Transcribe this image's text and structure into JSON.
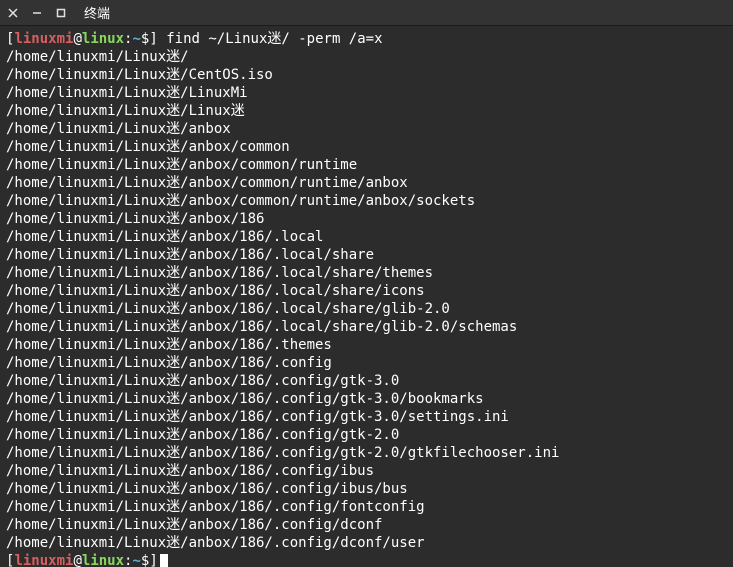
{
  "window": {
    "title": "终端"
  },
  "prompt": {
    "user": "linuxmi",
    "host": "linux",
    "path": "~",
    "bracket_open": "[",
    "bracket_close": "]",
    "at": "@",
    "colon": ":",
    "dollar": "$"
  },
  "command": "find ~/Linux迷/ -perm /a=x",
  "output": [
    "/home/linuxmi/Linux迷/",
    "/home/linuxmi/Linux迷/CentOS.iso",
    "/home/linuxmi/Linux迷/LinuxMi",
    "/home/linuxmi/Linux迷/Linux迷",
    "/home/linuxmi/Linux迷/anbox",
    "/home/linuxmi/Linux迷/anbox/common",
    "/home/linuxmi/Linux迷/anbox/common/runtime",
    "/home/linuxmi/Linux迷/anbox/common/runtime/anbox",
    "/home/linuxmi/Linux迷/anbox/common/runtime/anbox/sockets",
    "/home/linuxmi/Linux迷/anbox/186",
    "/home/linuxmi/Linux迷/anbox/186/.local",
    "/home/linuxmi/Linux迷/anbox/186/.local/share",
    "/home/linuxmi/Linux迷/anbox/186/.local/share/themes",
    "/home/linuxmi/Linux迷/anbox/186/.local/share/icons",
    "/home/linuxmi/Linux迷/anbox/186/.local/share/glib-2.0",
    "/home/linuxmi/Linux迷/anbox/186/.local/share/glib-2.0/schemas",
    "/home/linuxmi/Linux迷/anbox/186/.themes",
    "/home/linuxmi/Linux迷/anbox/186/.config",
    "/home/linuxmi/Linux迷/anbox/186/.config/gtk-3.0",
    "/home/linuxmi/Linux迷/anbox/186/.config/gtk-3.0/bookmarks",
    "/home/linuxmi/Linux迷/anbox/186/.config/gtk-3.0/settings.ini",
    "/home/linuxmi/Linux迷/anbox/186/.config/gtk-2.0",
    "/home/linuxmi/Linux迷/anbox/186/.config/gtk-2.0/gtkfilechooser.ini",
    "/home/linuxmi/Linux迷/anbox/186/.config/ibus",
    "/home/linuxmi/Linux迷/anbox/186/.config/ibus/bus",
    "/home/linuxmi/Linux迷/anbox/186/.config/fontconfig",
    "/home/linuxmi/Linux迷/anbox/186/.config/dconf",
    "/home/linuxmi/Linux迷/anbox/186/.config/dconf/user"
  ]
}
